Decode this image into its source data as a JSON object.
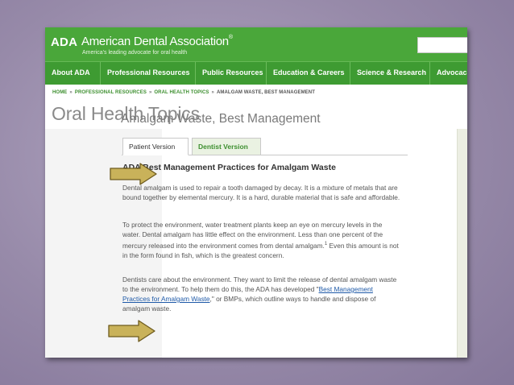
{
  "header": {
    "logo_abbr": "ADA",
    "org_name": "American Dental Association",
    "registered_mark": "®",
    "tagline": "America's leading advocate for oral health",
    "search_placeholder": ""
  },
  "nav": {
    "items": [
      {
        "label": "About ADA"
      },
      {
        "label": "Professional Resources"
      },
      {
        "label": "Public Resources"
      },
      {
        "label": "Education & Careers"
      },
      {
        "label": "Science & Research"
      },
      {
        "label": "Advocac"
      }
    ]
  },
  "breadcrumb": {
    "items": [
      "HOME",
      "PROFESSIONAL RESOURCES",
      "ORAL HEALTH TOPICS"
    ],
    "current": "AMALGAM WASTE, BEST MANAGEMENT",
    "separator": "»"
  },
  "page_title": "Oral Health Topics",
  "article": {
    "title": "Amalgam Waste, Best Management",
    "tabs": [
      {
        "label": "Patient Version",
        "active": true
      },
      {
        "label": "Dentist Version",
        "active": false
      }
    ],
    "heading": "ADA Best Management Practices for Amalgam Waste",
    "paragraph1": "Dental amalgam is used to repair a tooth damaged by decay. It is a mixture of metals that are bound together by elemental mercury. It is a hard, durable material that is safe and affordable.",
    "paragraph2_a": "To protect the environment, water treatment plants keep an eye on mercury levels in the water. Dental amalgam has little effect on the environment. Less than one percent of the mercury released into the environment comes from dental amalgam.",
    "paragraph2_sup": "1",
    "paragraph2_b": " Even this amount is not in the form found in fish, which is the greatest concern.",
    "paragraph3_a": "Dentists care about the environment. They want to limit the release of dental amalgam waste to the environment. To help them do this, the ADA has developed \"",
    "paragraph3_link": "Best Management Practices for Amalgam Waste",
    "paragraph3_b": ",\" or BMPs, which outline ways to handle and dispose of amalgam waste."
  },
  "colors": {
    "brand_green": "#4aa73a",
    "nav_green": "#3e9b32",
    "arrow_fill": "#c9b25a",
    "arrow_stroke": "#6e5b1e"
  },
  "icons": [
    "callout-arrow-icon"
  ]
}
